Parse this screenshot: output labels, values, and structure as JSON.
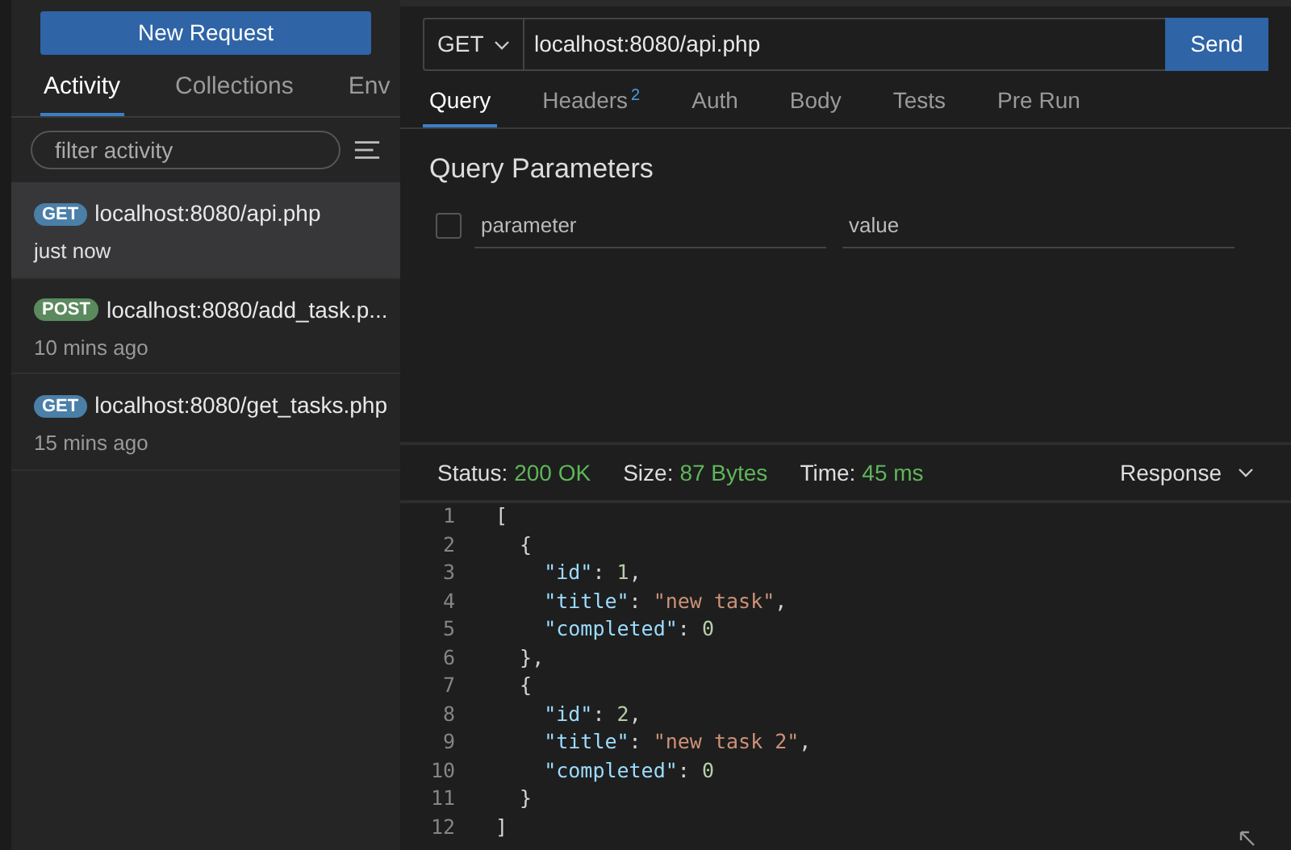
{
  "sidebar": {
    "new_button": "New Request",
    "tabs": [
      {
        "label": "Activity",
        "selected": true
      },
      {
        "label": "Collections",
        "selected": false
      },
      {
        "label": "Env",
        "selected": false
      }
    ],
    "filter": {
      "placeholder": "filter activity"
    },
    "items": [
      {
        "method": "GET",
        "url": "localhost:8080/api.php",
        "time": "just now",
        "selected": true
      },
      {
        "method": "POST",
        "url": "localhost:8080/add_task.p...",
        "time": "10 mins ago",
        "selected": false
      },
      {
        "method": "GET",
        "url": "localhost:8080/get_tasks.php",
        "time": "15 mins ago",
        "selected": false
      }
    ]
  },
  "request": {
    "method": "GET",
    "url": "localhost:8080/api.php",
    "send": "Send",
    "tabs": [
      {
        "label": "Query",
        "selected": true
      },
      {
        "label": "Headers",
        "badge": "2",
        "selected": false
      },
      {
        "label": "Auth",
        "selected": false
      },
      {
        "label": "Body",
        "selected": false
      },
      {
        "label": "Tests",
        "selected": false
      },
      {
        "label": "Pre Run",
        "selected": false
      }
    ],
    "section_title": "Query Parameters",
    "param": {
      "checked": false,
      "name_placeholder": "parameter",
      "value_placeholder": "value"
    }
  },
  "response": {
    "status_label": "Status:",
    "status": "200 OK",
    "size_label": "Size:",
    "size": "87 Bytes",
    "time_label": "Time:",
    "time": "45 ms",
    "view": "Response",
    "lines": [
      {
        "number": "1",
        "tokens": [
          {
            "kind": "punct",
            "text": "["
          }
        ]
      },
      {
        "number": "2",
        "tokens": [
          {
            "kind": "punct",
            "text": "  {"
          }
        ]
      },
      {
        "number": "3",
        "tokens": [
          {
            "kind": "key",
            "text": "    \"id\""
          },
          {
            "kind": "punct",
            "text": ": "
          },
          {
            "kind": "number",
            "text": "1"
          },
          {
            "kind": "punct",
            "text": ","
          }
        ]
      },
      {
        "number": "4",
        "tokens": [
          {
            "kind": "key",
            "text": "    \"title\""
          },
          {
            "kind": "punct",
            "text": ": "
          },
          {
            "kind": "string",
            "text": "\"new task\""
          },
          {
            "kind": "punct",
            "text": ","
          }
        ]
      },
      {
        "number": "5",
        "tokens": [
          {
            "kind": "key",
            "text": "    \"completed\""
          },
          {
            "kind": "punct",
            "text": ": "
          },
          {
            "kind": "number",
            "text": "0"
          }
        ]
      },
      {
        "number": "6",
        "tokens": [
          {
            "kind": "punct",
            "text": "  },"
          }
        ]
      },
      {
        "number": "7",
        "tokens": [
          {
            "kind": "punct",
            "text": "  {"
          }
        ]
      },
      {
        "number": "8",
        "tokens": [
          {
            "kind": "key",
            "text": "    \"id\""
          },
          {
            "kind": "punct",
            "text": ": "
          },
          {
            "kind": "number",
            "text": "2"
          },
          {
            "kind": "punct",
            "text": ","
          }
        ]
      },
      {
        "number": "9",
        "tokens": [
          {
            "kind": "key",
            "text": "    \"title\""
          },
          {
            "kind": "punct",
            "text": ": "
          },
          {
            "kind": "string",
            "text": "\"new task 2\""
          },
          {
            "kind": "punct",
            "text": ","
          }
        ]
      },
      {
        "number": "10",
        "tokens": [
          {
            "kind": "key",
            "text": "    \"completed\""
          },
          {
            "kind": "punct",
            "text": ": "
          },
          {
            "kind": "number",
            "text": "0"
          }
        ]
      },
      {
        "number": "11",
        "tokens": [
          {
            "kind": "punct",
            "text": "  }"
          }
        ]
      },
      {
        "number": "12",
        "tokens": [
          {
            "kind": "punct",
            "text": "]"
          }
        ]
      }
    ]
  }
}
